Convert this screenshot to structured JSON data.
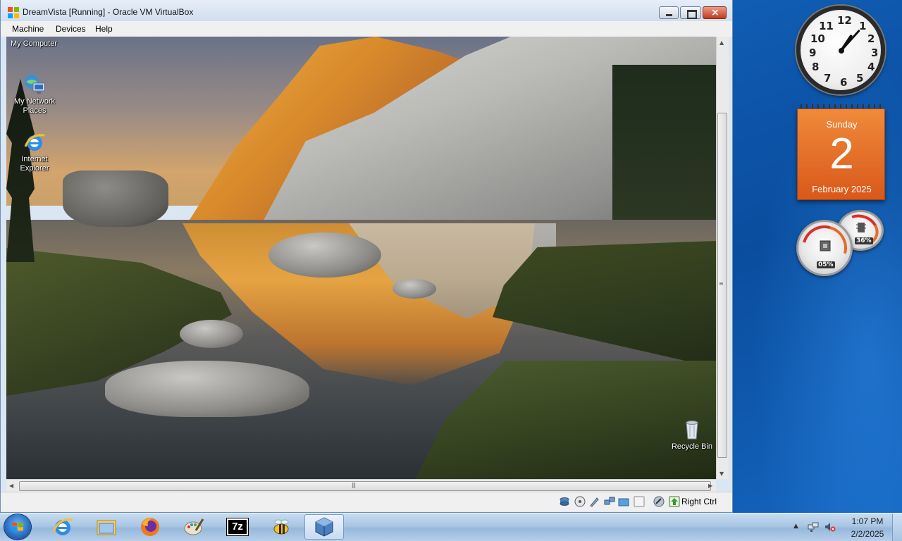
{
  "window": {
    "title": "DreamVista [Running] - Oracle VM VirtualBox",
    "menu": [
      "Machine",
      "Devices",
      "Help"
    ],
    "hostkey_label": "Right Ctrl"
  },
  "guest": {
    "icons": {
      "my_computer": "My Computer",
      "network_line1": "My Network",
      "network_line2": "Places",
      "ie_line1": "Internet",
      "ie_line2": "Explorer",
      "recycle": "Recycle Bin"
    }
  },
  "gadgets": {
    "clock_numbers": [
      "12",
      "1",
      "2",
      "3",
      "4",
      "5",
      "6",
      "7",
      "8",
      "9",
      "10",
      "11"
    ],
    "calendar": {
      "day": "Sunday",
      "date": "2",
      "month": "February 2025"
    },
    "cpu_meter": {
      "value": "05%"
    },
    "memory_meter": {
      "value": "36%"
    }
  },
  "taskbar": {
    "pinned": [
      "internet-explorer-icon",
      "windows-explorer-icon",
      "firefox-icon",
      "paint-icon",
      "7zip-icon",
      "bee-app-icon",
      "virtualbox-icon"
    ],
    "zip_label": "7z",
    "clock": {
      "time": "1:07 PM",
      "date": "2/2/2025"
    }
  },
  "colors": {
    "calendar_orange": "#e2661f",
    "titlebar": "#dbe6f3",
    "desktop_blue": "#0e57ad"
  }
}
